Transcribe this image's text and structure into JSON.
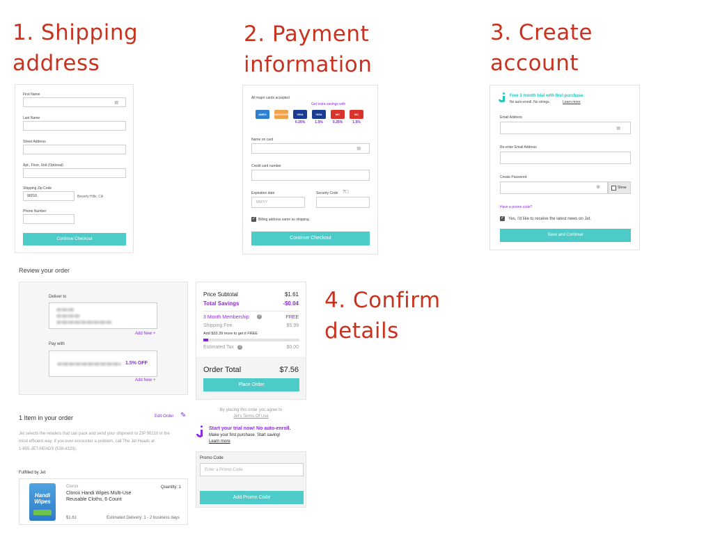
{
  "steps": {
    "s1": "1. Shipping address",
    "s1_line1": "1. Shipping",
    "s1_line2": "address",
    "s2_line1": "2. Payment",
    "s2_line2": "information",
    "s3_line1": "3. Create",
    "s3_line2": "account",
    "s4_line1": "4. Confirm",
    "s4_line2": "details"
  },
  "shipping": {
    "first_name_label": "First Name",
    "last_name_label": "Last Name",
    "street_label": "Street Address",
    "apt_label": "Apt., Floor, Unit (Optional)",
    "zip_label": "Shipping Zip Code",
    "zip_value": "90210",
    "city_state": "Beverly Hills, CA",
    "phone_label": "Phone Number",
    "continue_button": "Continue Checkout"
  },
  "payment": {
    "cards_label": "All major cards accepted",
    "extra_savings": "Get extra savings with",
    "cards": [
      {
        "name": "AMEX",
        "color": "#2f7fd1",
        "pct": ""
      },
      {
        "name": "DISCOVER",
        "color": "#f0a24a",
        "pct": ""
      },
      {
        "name": "VISA",
        "color": "#1a3b8f",
        "pct": "0.25%"
      },
      {
        "name": "VISA",
        "color": "#1a3b8f",
        "pct": "1.5%"
      },
      {
        "name": "MC",
        "color": "#d9342b",
        "pct": "0.25%"
      },
      {
        "name": "MC",
        "color": "#d9342b",
        "pct": "1.5%"
      }
    ],
    "name_label": "Name on card",
    "cc_label": "Credit card number",
    "exp_label": "Expiration date",
    "exp_placeholder": "MM/YY",
    "sec_label": "Security Code",
    "billing_same": "Billing address same as shipping",
    "continue_button": "Continue Checkout"
  },
  "account": {
    "trial_title": "Free 3 month trial with first purchase.",
    "trial_sub": "No auto-enroll. No strings.",
    "learn_more": "Learn more",
    "email_label": "Email Address",
    "reenter_label": "Re-enter Email Address",
    "password_label": "Create Password",
    "show_label": "Show",
    "promo_link": "Have a promo code?",
    "news_label": "Yes, I'd like to receive the latest news on Jet.",
    "save_button": "Save and Continue"
  },
  "review": {
    "heading": "Review your order",
    "deliver_to": "Deliver to",
    "add_new_1": "Add New +",
    "pay_with": "Pay with",
    "pay_off": "1.5% OFF",
    "add_new_2": "Add New +"
  },
  "summary": {
    "subtotal_label": "Price Subtotal",
    "subtotal_value": "$1.61",
    "savings_label": "Total Savings",
    "savings_value": "-$0.04",
    "membership_label": "3 Month Membership",
    "membership_value": "FREE",
    "shipping_label": "Shipping Fee",
    "shipping_value": "$5.99",
    "free_note": "Add $33.39 more to get it FREE",
    "free_progress": 0.05,
    "tax_label": "Estimated Tax",
    "tax_value": "$0.00",
    "total_label": "Order Total",
    "total_value": "$7.56",
    "place_order": "Place Order",
    "terms_line1": "By placing this order you agree to",
    "terms_line2": "Jet's Terms Of Use",
    "trial_title": "Start your trial now! No auto-enroll.",
    "trial_sub": "Make your first purchase. Start saving!",
    "learn_more": "Learn more",
    "promo_label": "Promo Code",
    "promo_placeholder": "Enter a Promo Code",
    "add_promo": "Add Promo Code"
  },
  "items": {
    "heading": "1 Item in your order",
    "edit_order": "Edit Order",
    "note_line1": "Jet selects the retailers that can pack and send your shipment to ZIP 90210 in the",
    "note_line2": "most efficient way. If you ever encounter a problem, call The Jet Heads at",
    "note_line3": "1-855-JET-HEADS (538-4323).",
    "fulfilled_by": "Fulfilled by Jet",
    "brand": "Clorox",
    "product_line1": "Clorox Handi Wipes Multi-Use",
    "product_line2": "Reusable Cloths, 6 Count",
    "quantity": "Quantity: 1",
    "price": "$1.61",
    "delivery": "Estimated Delivery: 1 - 2 business days",
    "product_logo_line1": "Handi",
    "product_logo_line2": "Wipes"
  }
}
